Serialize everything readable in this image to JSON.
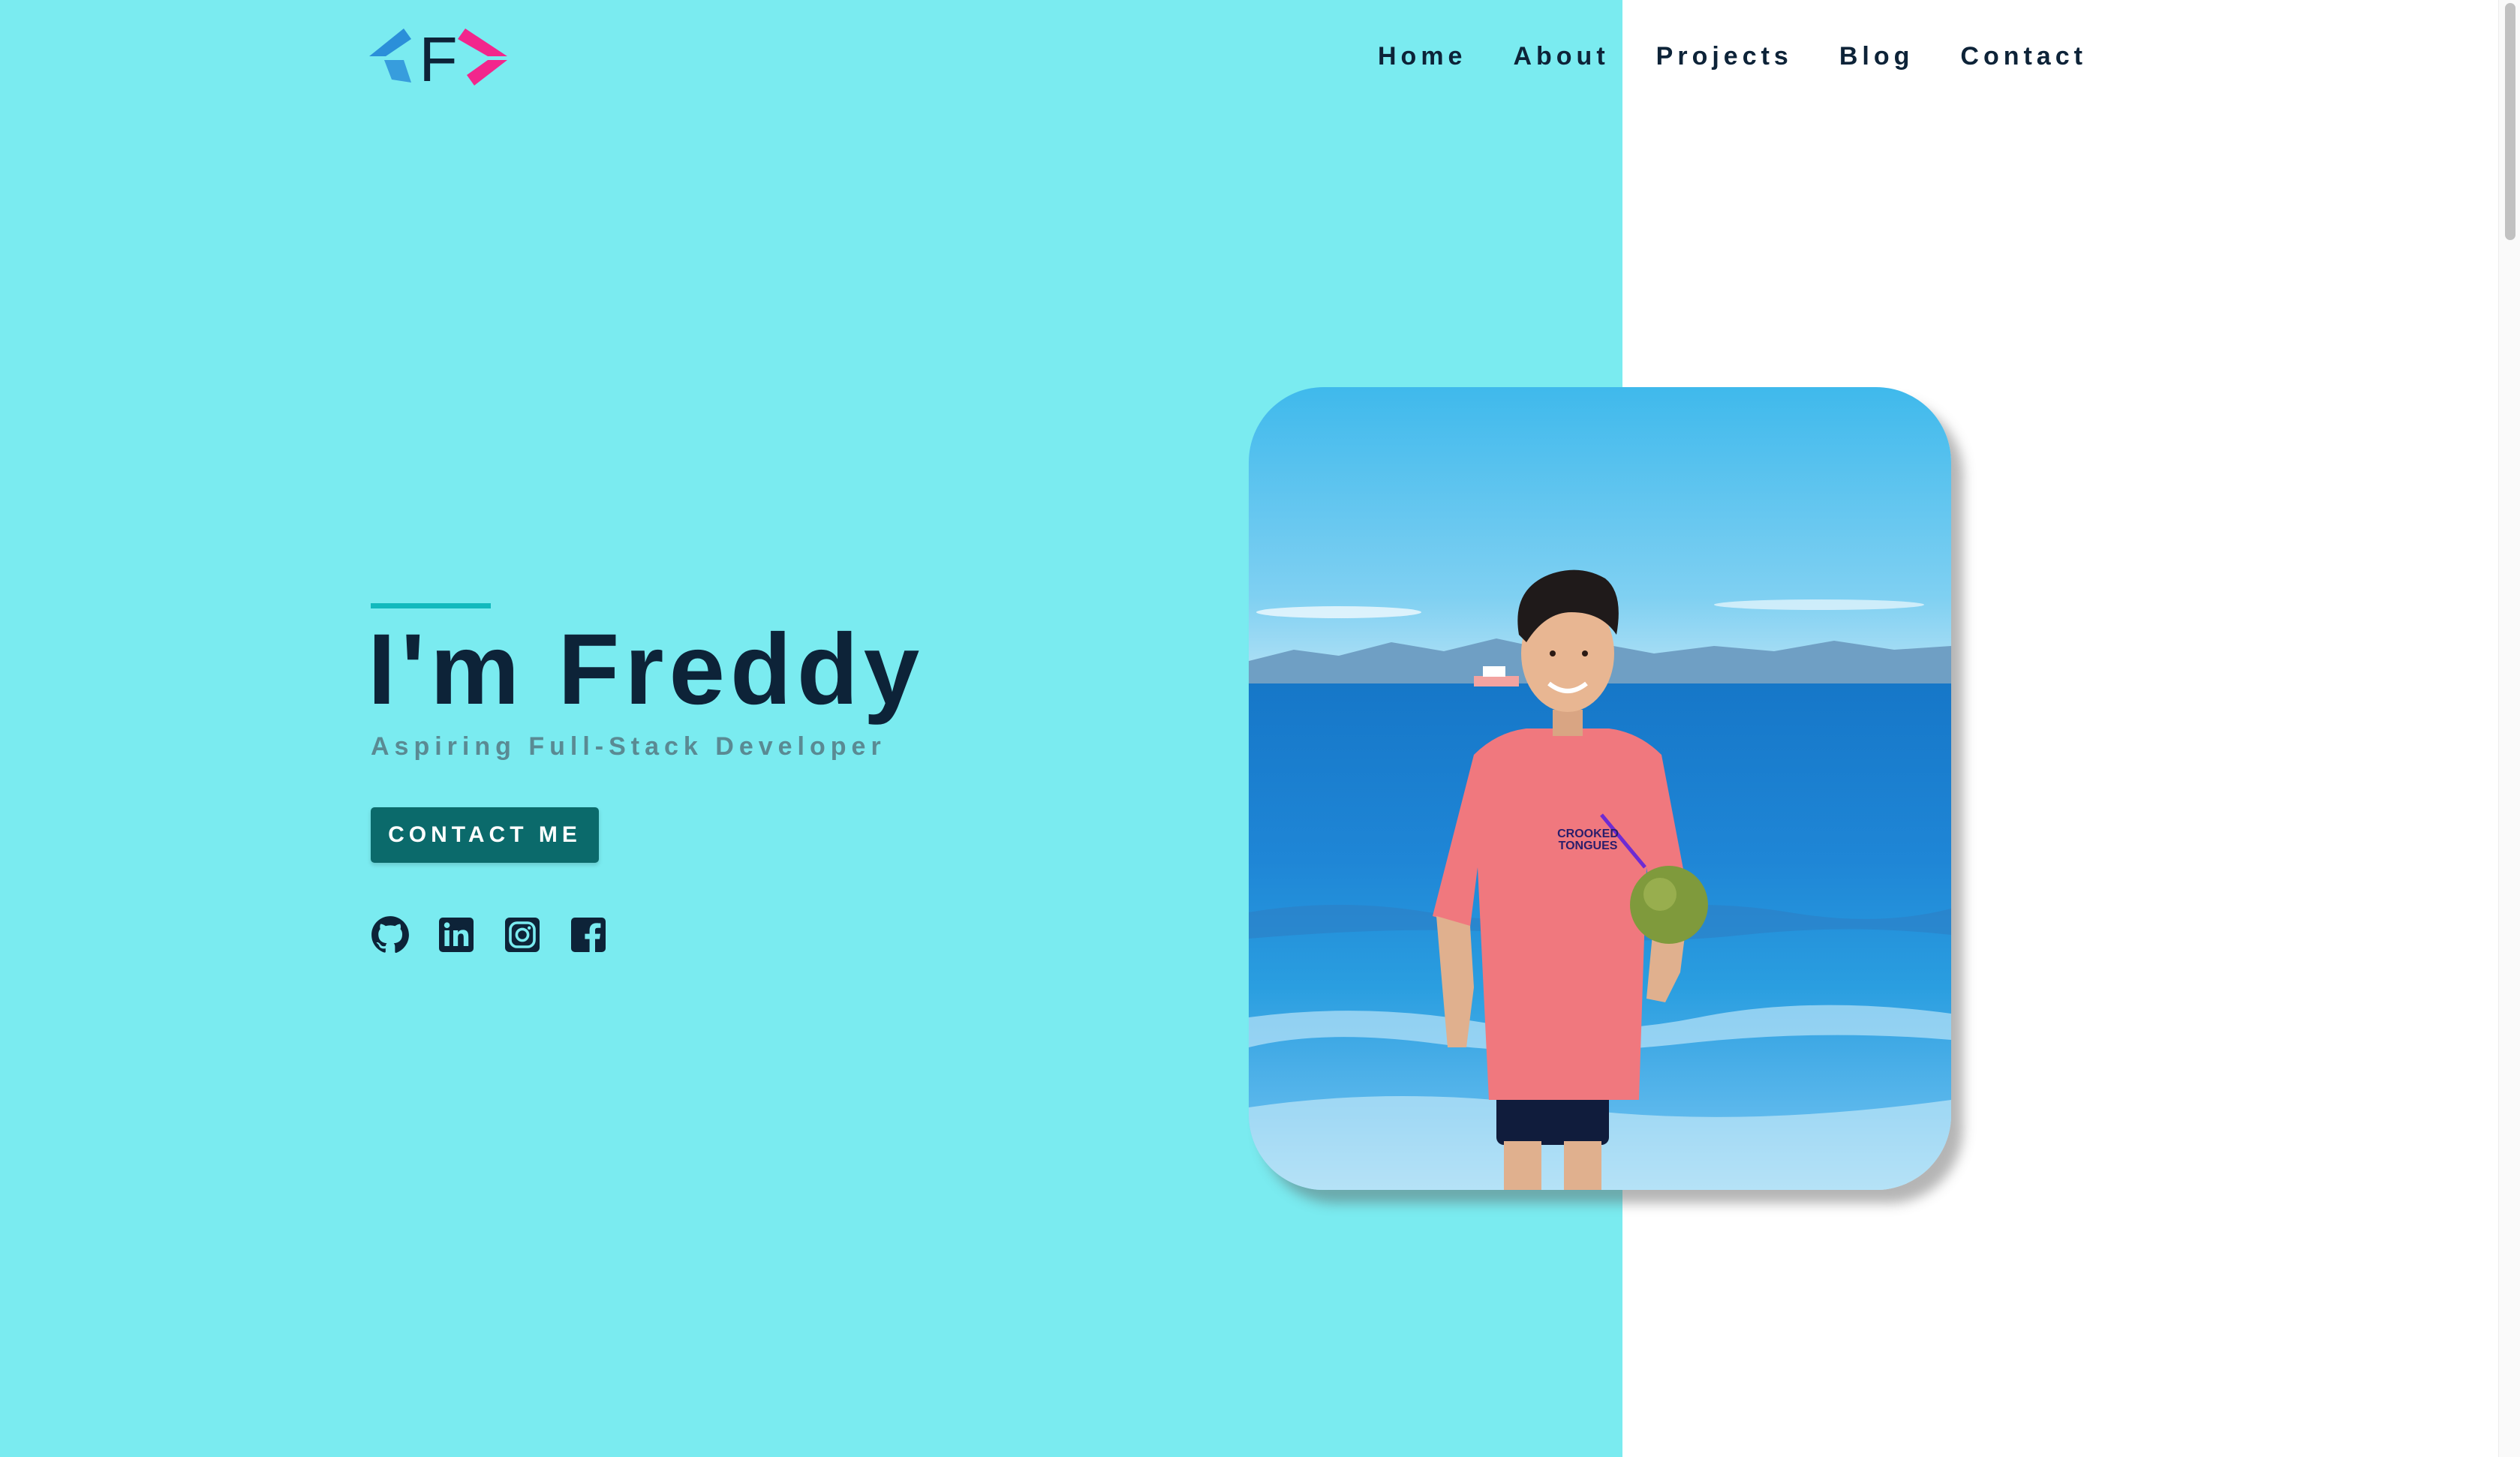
{
  "brand": {
    "logo_letter": "F",
    "logo_left_color": "#2b8fd9",
    "logo_right_color": "#f2268c",
    "logo_letter_color": "#0d2338"
  },
  "nav": {
    "items": [
      {
        "label": "Home"
      },
      {
        "label": "About"
      },
      {
        "label": "Projects"
      },
      {
        "label": "Blog"
      },
      {
        "label": "Contact"
      }
    ]
  },
  "hero": {
    "title": "I'm Freddy",
    "subtitle": "Aspiring Full-Stack Developer",
    "cta_label": "CONTACT ME"
  },
  "socials": [
    {
      "icon": "github-icon"
    },
    {
      "icon": "linkedin-icon"
    },
    {
      "icon": "instagram-icon"
    },
    {
      "icon": "facebook-icon"
    }
  ],
  "photo": {
    "subject": "profile-photo",
    "shirt_text_line1": "CROOKED",
    "shirt_text_line2": "TONGUES"
  },
  "colors": {
    "panel_bg": "#7aebf0",
    "text_dark": "#0d2338",
    "accent": "#12b9bd",
    "button_bg": "#0b6a6b",
    "subtitle": "#5a8a93"
  }
}
